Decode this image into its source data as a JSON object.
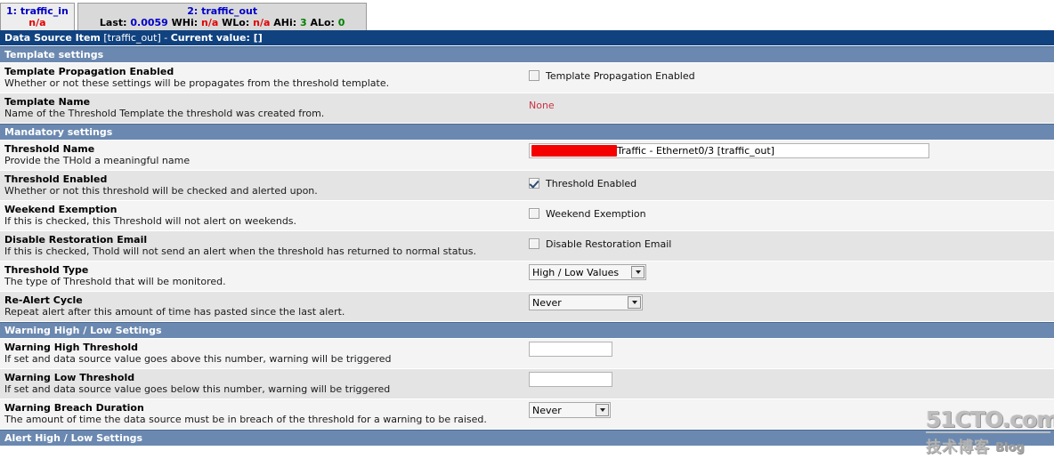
{
  "tabs": [
    {
      "name": "tab-traffic-in",
      "active": false,
      "line1": "1: traffic_in",
      "line2_segments": [
        {
          "text": "n/a",
          "color": "red"
        }
      ]
    },
    {
      "name": "tab-traffic-out",
      "active": true,
      "line1": "2: traffic_out",
      "line2_segments": [
        {
          "text": "Last:",
          "color": "black"
        },
        {
          "text": "0.0059",
          "color": "blue"
        },
        {
          "text": "WHi:",
          "color": "black"
        },
        {
          "text": "n/a",
          "color": "red"
        },
        {
          "text": "WLo:",
          "color": "black"
        },
        {
          "text": "n/a",
          "color": "red"
        },
        {
          "text": "AHi:",
          "color": "black"
        },
        {
          "text": "3",
          "color": "green"
        },
        {
          "text": "ALo:",
          "color": "black"
        },
        {
          "text": "0",
          "color": "green"
        }
      ]
    }
  ],
  "titlebar": {
    "bold_prefix": "Data Source Item",
    "plain_middle": " [traffic_out] - ",
    "bold_suffix": "Current value: []"
  },
  "sections": {
    "template_settings": "Template settings",
    "mandatory_settings": "Mandatory settings",
    "warning_high_low": "Warning High / Low Settings",
    "alert_high_low": "Alert High / Low Settings"
  },
  "fields": {
    "template_propagation": {
      "title": "Template Propagation Enabled",
      "desc": "Whether or not these settings will be propagates from the threshold template.",
      "checkbox_label": "Template Propagation Enabled",
      "checked": false
    },
    "template_name": {
      "title": "Template Name",
      "desc": "Name of the Threshold Template the threshold was created from.",
      "value": "None"
    },
    "threshold_name": {
      "title": "Threshold Name",
      "desc": "Provide the THold a meaningful name",
      "value": "Traffic - Ethernet0/3 [traffic_out]",
      "redacted_prefix": true
    },
    "threshold_enabled": {
      "title": "Threshold Enabled",
      "desc": "Whether or not this threshold will be checked and alerted upon.",
      "checkbox_label": "Threshold Enabled",
      "checked": true
    },
    "weekend_exemption": {
      "title": "Weekend Exemption",
      "desc": "If this is checked, this Threshold will not alert on weekends.",
      "checkbox_label": "Weekend Exemption",
      "checked": false
    },
    "disable_restoration_email": {
      "title": "Disable Restoration Email",
      "desc": "If this is checked, Thold will not send an alert when the threshold has returned to normal status.",
      "checkbox_label": "Disable Restoration Email",
      "checked": false
    },
    "threshold_type": {
      "title": "Threshold Type",
      "desc": "The type of Threshold that will be monitored.",
      "value": "High / Low Values"
    },
    "realert_cycle": {
      "title": "Re-Alert Cycle",
      "desc": "Repeat alert after this amount of time has pasted since the last alert.",
      "value": "Never"
    },
    "warning_high_threshold": {
      "title": "Warning High Threshold",
      "desc": "If set and data source value goes above this number, warning will be triggered",
      "value": ""
    },
    "warning_low_threshold": {
      "title": "Warning Low Threshold",
      "desc": "If set and data source value goes below this number, warning will be triggered",
      "value": ""
    },
    "warning_breach_duration": {
      "title": "Warning Breach Duration",
      "desc": "The amount of time the data source must be in breach of the threshold for a warning to be raised.",
      "value": "Never"
    }
  },
  "watermark": {
    "main": "51CTO.com",
    "cn": "技术博客",
    "blog": "Blog"
  },
  "colors": {
    "titlebar_bg": "#10427f",
    "sectionbar_bg": "#6b89b0",
    "row_odd_bg": "#f4f4f4",
    "row_even_bg": "#e4e4e4",
    "link_red": "#cc3344",
    "value_blue": "#0000c8",
    "value_green": "#008000",
    "redaction": "#f40000"
  }
}
